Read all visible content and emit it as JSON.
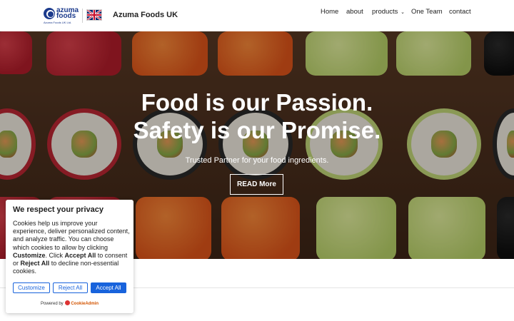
{
  "header": {
    "logo": {
      "line1": "azuma",
      "line2": "foods",
      "sub": "Azuma Foods UK Ltd."
    },
    "brand_title": "Azuma Foods UK",
    "flag_icon": "uk-flag-icon",
    "nav": [
      {
        "label": "Home"
      },
      {
        "label": "about"
      },
      {
        "label": "products",
        "icon": "chevron-down-icon",
        "chevron": "⌄"
      },
      {
        "label": "One Team"
      },
      {
        "label": "contact"
      }
    ]
  },
  "hero": {
    "title_line1": "Food is our Passion.",
    "title_line2": "Safety is our Promise.",
    "subtitle": "Trusted Partner for your food ingredients.",
    "button": "READ More"
  },
  "cookie": {
    "title": "We respect your privacy",
    "text_part1": "Cookies help us improve your experience, deliver personalized content, and analyze traffic. You can choose which cookies to allow by clicking ",
    "bold_customize": "Customize",
    "text_part2": ". Click ",
    "bold_accept": "Accept All",
    "text_part3": " to consent or ",
    "bold_reject": "Reject All",
    "text_part4": " to decline non-essential cookies.",
    "buttons": {
      "customize": "Customize",
      "reject": "Reject All",
      "accept": "Accept All"
    },
    "powered_by": "Powered by",
    "powered_brand": "CookieAdmin"
  },
  "colors": {
    "accent": "#1863dc",
    "brand": "#1b3a8c"
  }
}
